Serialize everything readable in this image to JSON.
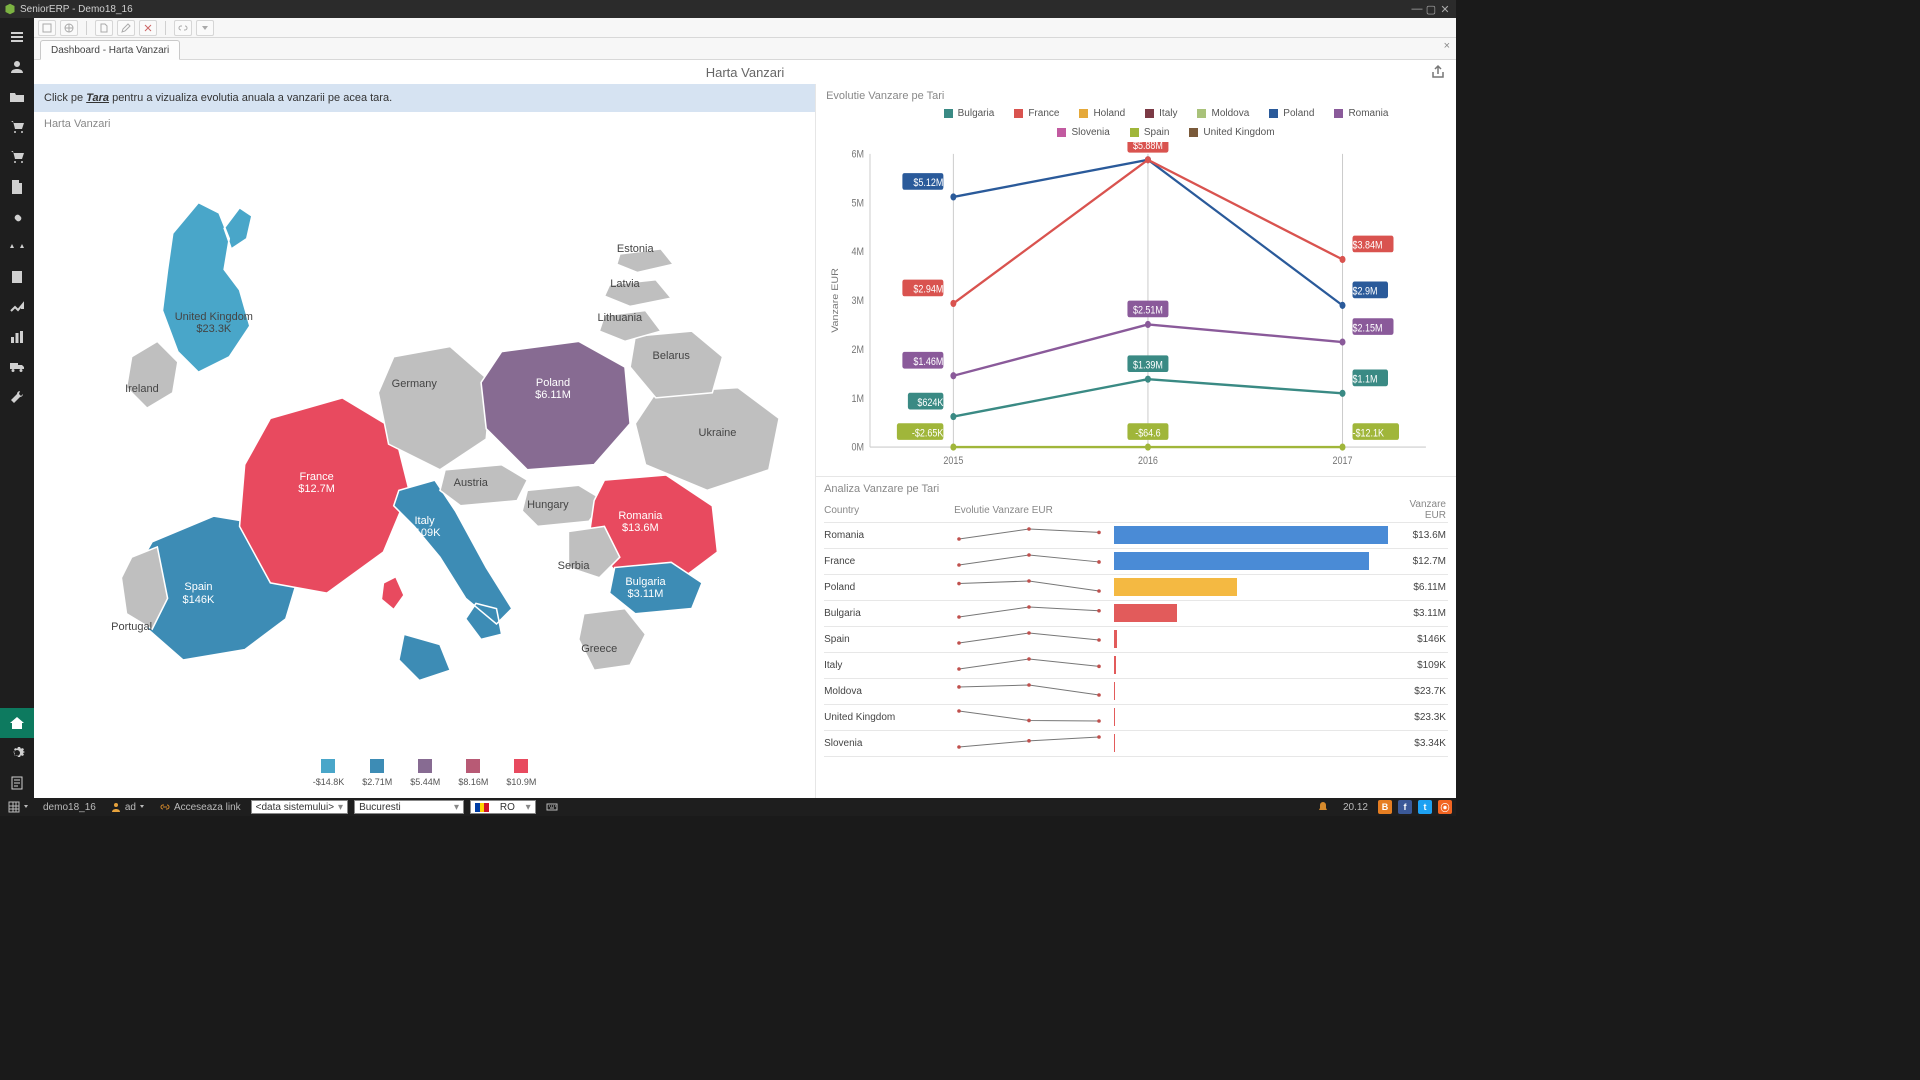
{
  "app": {
    "title": "SeniorERP - Demo18_16"
  },
  "tabs": [
    {
      "label": "Dashboard - Harta Vanzari"
    }
  ],
  "dashboard": {
    "title": "Harta Vanzari",
    "hint_prefix": "Click pe ",
    "hint_key": "Tara",
    "hint_suffix": " pentru a vizualiza evolutia anuala a vanzarii pe acea tara."
  },
  "map": {
    "title": "Harta Vanzari",
    "legend": [
      {
        "color": "#49a6c9",
        "label": "-$14.8K"
      },
      {
        "color": "#3d8cb5",
        "label": "$2.71M"
      },
      {
        "color": "#876b92",
        "label": "$5.44M"
      },
      {
        "color": "#b85a75",
        "label": "$8.16M"
      },
      {
        "color": "#e84a5f",
        "label": "$10.9M"
      }
    ],
    "countries": [
      {
        "name": "United Kingdom",
        "value": "$23.3K",
        "color": "#49a6c9"
      },
      {
        "name": "Ireland",
        "value": "",
        "color": "#bfbfbf"
      },
      {
        "name": "Spain",
        "value": "$146K",
        "color": "#3d8cb5"
      },
      {
        "name": "Portugal",
        "value": "",
        "color": "#bfbfbf"
      },
      {
        "name": "France",
        "value": "$12.7M",
        "color": "#e84a5f"
      },
      {
        "name": "Germany",
        "value": "",
        "color": "#bfbfbf"
      },
      {
        "name": "Italy",
        "value": "$109K",
        "color": "#3d8cb5"
      },
      {
        "name": "Austria",
        "value": "",
        "color": "#bfbfbf"
      },
      {
        "name": "Poland",
        "value": "$6.11M",
        "color": "#876b92"
      },
      {
        "name": "Hungary",
        "value": "",
        "color": "#bfbfbf"
      },
      {
        "name": "Romania",
        "value": "$13.6M",
        "color": "#e84a5f"
      },
      {
        "name": "Bulgaria",
        "value": "$3.11M",
        "color": "#3d8cb5"
      },
      {
        "name": "Serbia",
        "value": "",
        "color": "#bfbfbf"
      },
      {
        "name": "Greece",
        "value": "",
        "color": "#bfbfbf"
      },
      {
        "name": "Ukraine",
        "value": "",
        "color": "#bfbfbf"
      },
      {
        "name": "Belarus",
        "value": "",
        "color": "#bfbfbf"
      },
      {
        "name": "Lithuania",
        "value": "",
        "color": "#bfbfbf"
      },
      {
        "name": "Latvia",
        "value": "",
        "color": "#bfbfbf"
      },
      {
        "name": "Estonia",
        "value": "",
        "color": "#bfbfbf"
      }
    ]
  },
  "line": {
    "title": "Evolutie Vanzare pe Tari",
    "ylabel": "Vanzare EUR",
    "ylim": [
      0,
      6000000
    ],
    "yticks": [
      "0M",
      "1M",
      "2M",
      "3M",
      "4M",
      "5M",
      "6M"
    ],
    "categories": [
      "2015",
      "2016",
      "2017"
    ],
    "legend": [
      {
        "name": "Bulgaria",
        "color": "#3a8a84"
      },
      {
        "name": "France",
        "color": "#d9534f"
      },
      {
        "name": "Holand",
        "color": "#e5a93a"
      },
      {
        "name": "Italy",
        "color": "#7b3a45"
      },
      {
        "name": "Moldova",
        "color": "#a9c27a"
      },
      {
        "name": "Poland",
        "color": "#2a5a9a"
      },
      {
        "name": "Romania",
        "color": "#8a5a9a"
      },
      {
        "name": "Slovenia",
        "color": "#c25aa0"
      },
      {
        "name": "Spain",
        "color": "#a0b63a"
      },
      {
        "name": "United Kingdom",
        "color": "#7a5a3a"
      }
    ],
    "series": [
      {
        "name": "Poland",
        "color": "#2a5a9a",
        "values": [
          5120000,
          5880000,
          2900000
        ],
        "labels": [
          "$5.12M",
          "$5.88M",
          "$2.9M"
        ],
        "label_on": [
          0,
          2
        ]
      },
      {
        "name": "France",
        "color": "#d9534f",
        "values": [
          2940000,
          5880000,
          3840000
        ],
        "labels": [
          "$2.94M",
          "$5.88M",
          "$3.84M"
        ],
        "label_on": [
          0,
          1,
          2
        ]
      },
      {
        "name": "Romania",
        "color": "#8a5a9a",
        "values": [
          1460000,
          2510000,
          2150000
        ],
        "labels": [
          "$1.46M",
          "$2.51M",
          "$2.15M"
        ],
        "label_on": [
          0,
          1,
          2
        ]
      },
      {
        "name": "Bulgaria",
        "color": "#3a8a84",
        "values": [
          624000,
          1390000,
          1100000
        ],
        "labels": [
          "$624K",
          "$1.39M",
          "$1.1M"
        ],
        "label_on": [
          0,
          1,
          2
        ]
      },
      {
        "name": "Spain",
        "color": "#a0b63a",
        "values": [
          -2650,
          -64,
          -12100
        ],
        "labels": [
          "-$2.65K",
          "-$64.6",
          "-$12.1K"
        ],
        "label_on": [
          0,
          1,
          2
        ]
      }
    ]
  },
  "table": {
    "title": "Analiza Vanzare pe Tari",
    "columns": [
      "Country",
      "Evolutie Vanzare EUR",
      "Vanzare EUR"
    ],
    "rows": [
      {
        "country": "Romania",
        "spark": [
          1460000,
          2510000,
          2150000
        ],
        "bar_frac": 1.0,
        "bar_color": "#4a8bd6",
        "value": "$13.6M"
      },
      {
        "country": "France",
        "spark": [
          2940000,
          5880000,
          3840000
        ],
        "bar_frac": 0.93,
        "bar_color": "#4a8bd6",
        "value": "$12.7M"
      },
      {
        "country": "Poland",
        "spark": [
          5120000,
          5880000,
          2900000
        ],
        "bar_frac": 0.45,
        "bar_color": "#f4b942",
        "value": "$6.11M"
      },
      {
        "country": "Bulgaria",
        "spark": [
          624000,
          1390000,
          1100000
        ],
        "bar_frac": 0.23,
        "bar_color": "#e25b5b",
        "value": "$3.11M"
      },
      {
        "country": "Spain",
        "spark": [
          40000,
          60000,
          46000
        ],
        "bar_frac": 0.011,
        "bar_color": "#e25b5b",
        "value": "$146K"
      },
      {
        "country": "Italy",
        "spark": [
          30000,
          45000,
          34000
        ],
        "bar_frac": 0.008,
        "bar_color": "#e25b5b",
        "value": "$109K"
      },
      {
        "country": "Moldova",
        "spark": [
          10000,
          12000,
          1700
        ],
        "bar_frac": 0.002,
        "bar_color": "#e25b5b",
        "value": "$23.7K"
      },
      {
        "country": "United Kingdom",
        "spark": [
          16000,
          4000,
          3300
        ],
        "bar_frac": 0.002,
        "bar_color": "#e25b5b",
        "value": "$23.3K"
      },
      {
        "country": "Slovenia",
        "spark": [
          500,
          1200,
          1640
        ],
        "bar_frac": 0.001,
        "bar_color": "#e25b5b",
        "value": "$3.34K"
      }
    ]
  },
  "status": {
    "db": "demo18_16",
    "usericon": "ad",
    "link": "Acceseaza link",
    "sysdate": "<data sistemului>",
    "city": "Bucuresti",
    "locale_code": "RO",
    "time": "20.12"
  },
  "chart_data": {
    "map": {
      "type": "choropleth",
      "title": "Harta Vanzari",
      "region": "Europe",
      "value_label": "Vanzare EUR",
      "data": {
        "United Kingdom": 23300,
        "Spain": 146000,
        "France": 12700000,
        "Italy": 109000,
        "Poland": 6110000,
        "Romania": 13600000,
        "Bulgaria": 3110000
      },
      "color_stops": [
        {
          "value": -14800,
          "color": "#49a6c9"
        },
        {
          "value": 2710000,
          "color": "#3d8cb5"
        },
        {
          "value": 5440000,
          "color": "#876b92"
        },
        {
          "value": 8160000,
          "color": "#b85a75"
        },
        {
          "value": 10900000,
          "color": "#e84a5f"
        }
      ]
    },
    "line": {
      "type": "line",
      "title": "Evolutie Vanzare pe Tari",
      "xlabel": "",
      "ylabel": "Vanzare EUR",
      "ylim": [
        0,
        6000000
      ],
      "categories": [
        "2015",
        "2016",
        "2017"
      ],
      "series": [
        {
          "name": "Poland",
          "values": [
            5120000,
            5880000,
            2900000
          ]
        },
        {
          "name": "France",
          "values": [
            2940000,
            5880000,
            3840000
          ]
        },
        {
          "name": "Romania",
          "values": [
            1460000,
            2510000,
            2150000
          ]
        },
        {
          "name": "Bulgaria",
          "values": [
            624000,
            1390000,
            1100000
          ]
        },
        {
          "name": "Spain",
          "values": [
            -2650,
            -64.6,
            -12100
          ]
        }
      ]
    },
    "table_bars": {
      "type": "bar",
      "orientation": "horizontal",
      "title": "Analiza Vanzare pe Tari",
      "categories": [
        "Romania",
        "France",
        "Poland",
        "Bulgaria",
        "Spain",
        "Italy",
        "Moldova",
        "United Kingdom",
        "Slovenia"
      ],
      "values": [
        13600000,
        12700000,
        6110000,
        3110000,
        146000,
        109000,
        23700,
        23300,
        3340
      ]
    }
  }
}
